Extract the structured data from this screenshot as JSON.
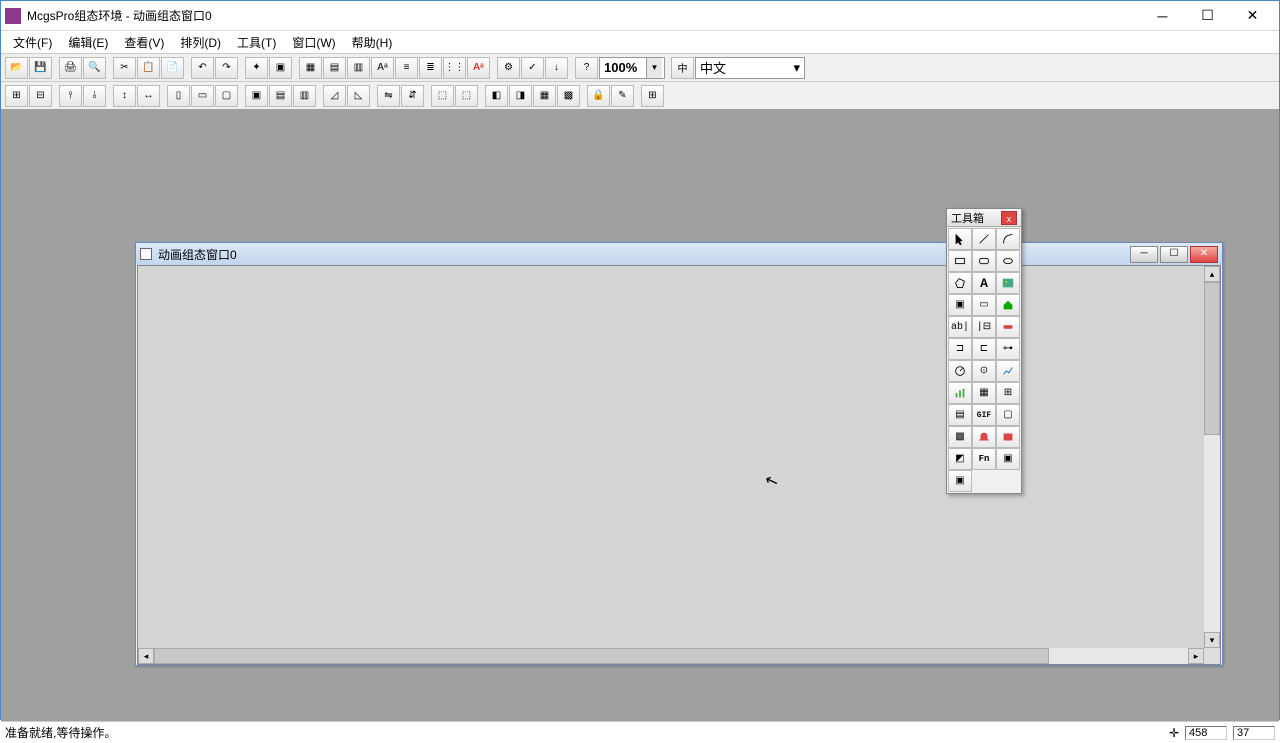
{
  "title": "McgsPro组态环境 - 动画组态窗口0",
  "menus": [
    "文件(F)",
    "编辑(E)",
    "查看(V)",
    "排列(D)",
    "工具(T)",
    "窗口(W)",
    "帮助(H)"
  ],
  "zoom": "100%",
  "language": "中文",
  "child_title": "动画组态窗口0",
  "toolbox_title": "工具箱",
  "status": "准备就绪,等待操作。",
  "coord_x": "458",
  "coord_y": "37"
}
